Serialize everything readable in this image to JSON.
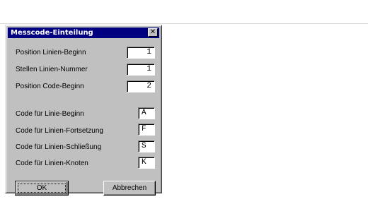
{
  "dialog": {
    "title": "Messcode-Einteilung",
    "close_glyph": "✕",
    "numeric_fields": [
      {
        "label": "Position Linien-Beginn",
        "value": "1"
      },
      {
        "label": "Stellen Linien-Nummer",
        "value": "1"
      },
      {
        "label": "Position Code-Beginn",
        "value": "2"
      }
    ],
    "code_fields": [
      {
        "label": "Code für Linie-Beginn",
        "value": "A"
      },
      {
        "label": "Code für Linien-Fortsetzung",
        "value": "F"
      },
      {
        "label": "Code für Linien-Schließung",
        "value": "S"
      },
      {
        "label": "Code für Linien-Knoten",
        "value": "K"
      }
    ],
    "ok_label": "OK",
    "cancel_label": "Abbrechen"
  },
  "colors": {
    "title_bar": "#000080",
    "dialog_face": "#c0c0c0",
    "page_background": "#ffffff"
  }
}
